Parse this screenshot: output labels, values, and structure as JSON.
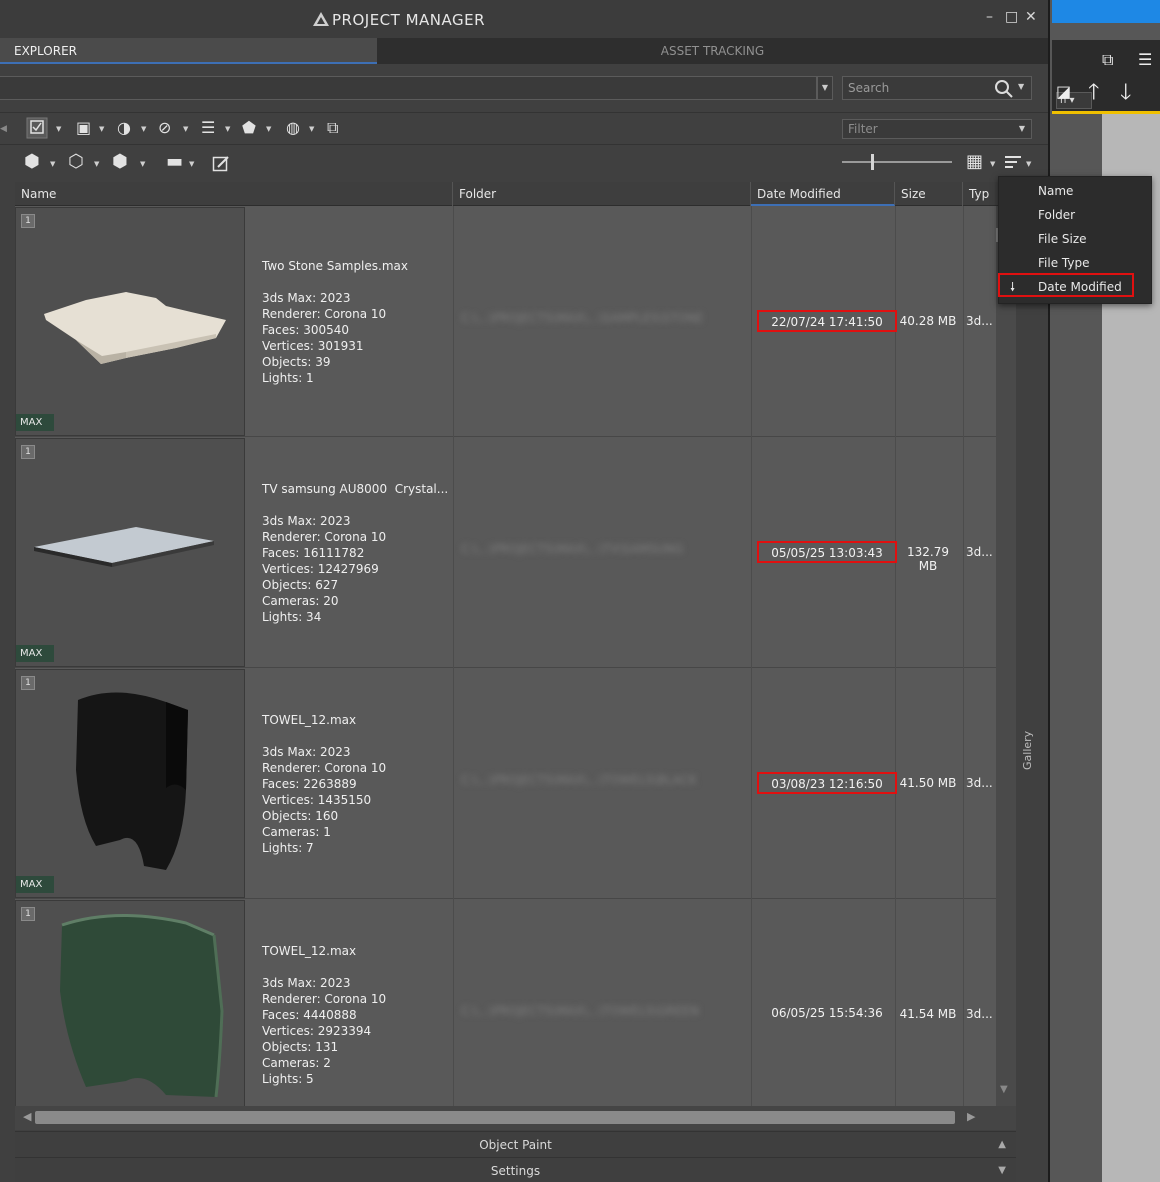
{
  "window": {
    "title": "PROJECT MANAGER",
    "minimize": "–",
    "maximize": "□",
    "close": "✕"
  },
  "tabs": [
    {
      "label": "EXPLORER"
    },
    {
      "label": "ASSET TRACKING"
    }
  ],
  "search": {
    "placeholder": "Search"
  },
  "filter": {
    "placeholder": "Filter"
  },
  "grid": {
    "columns": [
      "Name",
      "Folder",
      "Date Modified",
      "Size",
      "Typ"
    ],
    "rows": [
      {
        "index": "1",
        "badge": "MAX",
        "info": "Two Stone Samples.max\n\n3ds Max: 2023\nRenderer: Corona 10\nFaces: 300540\nVertices: 301931\nObjects: 39\nLights: 1",
        "folder": "C:\\...\\PROJECTS\\MAX\\...\\SAMPLES\\STONE",
        "date": "22/07/24 17:41:50",
        "size": "40.28 MB",
        "type": "3d..."
      },
      {
        "index": "1",
        "badge": "MAX",
        "info": "TV samsung AU8000  Crystal...\n\n3ds Max: 2023\nRenderer: Corona 10\nFaces: 16111782\nVertices: 12427969\nObjects: 627\nCameras: 20\nLights: 34",
        "folder": "C:\\...\\PROJECTS\\MAX\\...\\TV\\SAMSUNG",
        "date": "05/05/25 13:03:43",
        "size": "132.79 MB",
        "type": "3d..."
      },
      {
        "index": "1",
        "badge": "MAX",
        "info": "TOWEL_12.max\n\n3ds Max: 2023\nRenderer: Corona 10\nFaces: 2263889\nVertices: 1435150\nObjects: 160\nCameras: 1\nLights: 7",
        "folder": "C:\\...\\PROJECTS\\MAX\\...\\TOWELS\\BLACK",
        "date": "03/08/23 12:16:50",
        "size": "41.50 MB",
        "type": "3d..."
      },
      {
        "index": "1",
        "badge": "",
        "info": "TOWEL_12.max\n\n3ds Max: 2023\nRenderer: Corona 10\nFaces: 4440888\nVertices: 2923394\nObjects: 131\nCameras: 2\nLights: 5",
        "folder": "C:\\...\\PROJECTS\\MAX\\...\\TOWELS\\GREEN",
        "date": "06/05/25 15:54:36",
        "size": "41.54 MB",
        "type": "3d..."
      }
    ]
  },
  "sort_menu": {
    "items": [
      "Name",
      "Folder",
      "File Size",
      "File Type",
      "Date Modified"
    ],
    "selected": "Date Modified"
  },
  "panels": {
    "object_paint": "Object Paint",
    "settings": "Settings"
  },
  "side_tab": {
    "gallery": "Gallery"
  },
  "colors": {
    "highlight": "#e01010",
    "accent": "#3d6fb5",
    "host_blue": "#1e88e5"
  },
  "icons": [
    "search-icon",
    "arrow-up-icon",
    "arrow-down-icon",
    "sort-icon",
    "view-mode-icon",
    "edit-icon"
  ]
}
